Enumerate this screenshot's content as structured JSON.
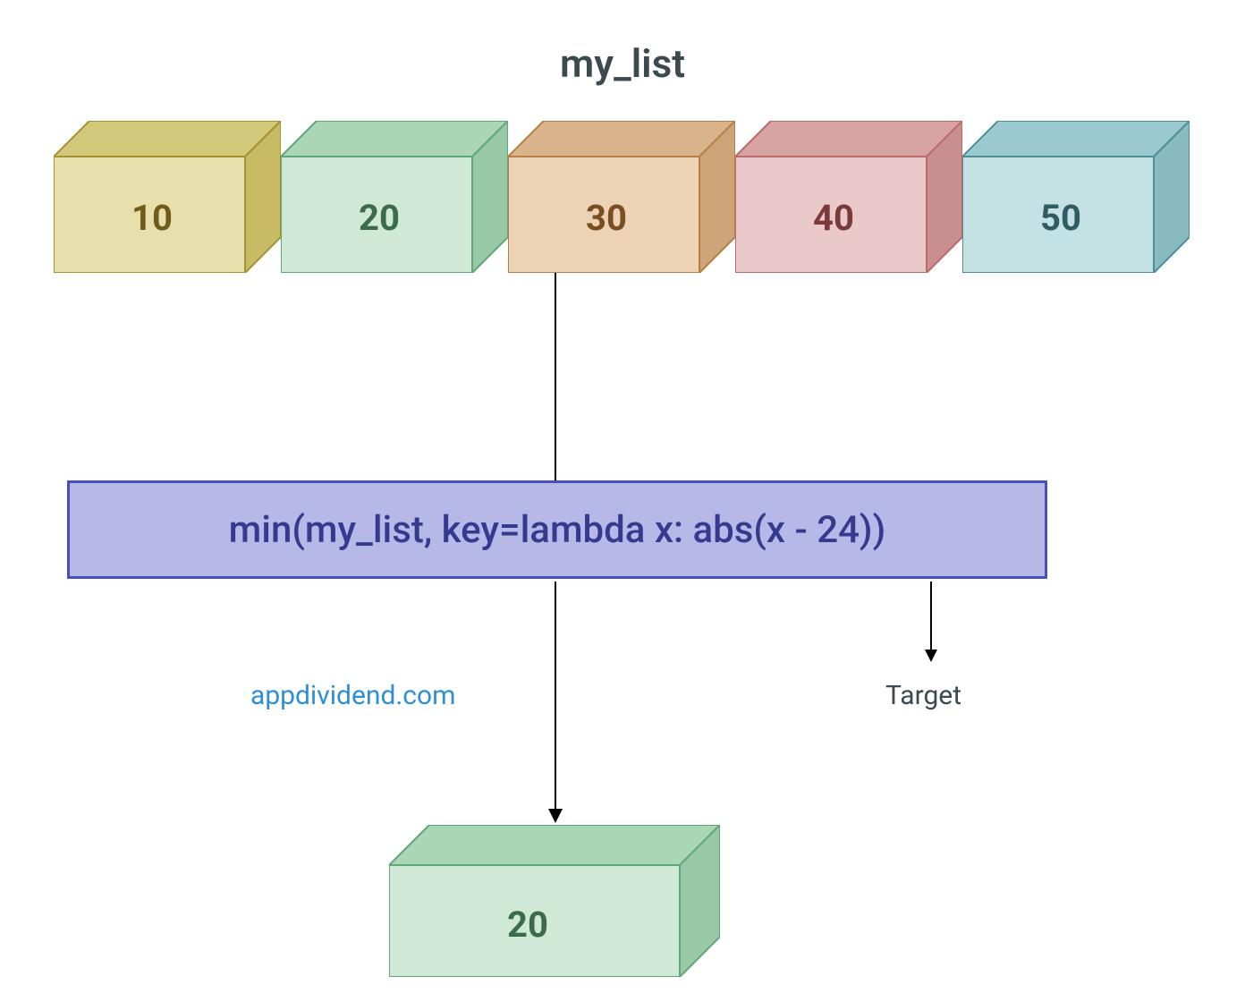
{
  "title": "my_list",
  "blocks": [
    {
      "value": "10",
      "front": "#e7dfac",
      "top": "#d3c87a",
      "side": "#c7bb66",
      "stroke": "#a59233",
      "text": "#6f5c1a"
    },
    {
      "value": "20",
      "front": "#cfe9d6",
      "top": "#aad6b6",
      "side": "#99c8a6",
      "stroke": "#5ea878",
      "text": "#3b6b4a"
    },
    {
      "value": "30",
      "front": "#ecd3b6",
      "top": "#d9b38a",
      "side": "#cca478",
      "stroke": "#b77f46",
      "text": "#7a4e20"
    },
    {
      "value": "40",
      "front": "#e9c9c9",
      "top": "#d7a3a3",
      "side": "#c98f8f",
      "stroke": "#bc6a6a",
      "text": "#7a3a3a"
    },
    {
      "value": "50",
      "front": "#c4e1e4",
      "top": "#9ac9cf",
      "side": "#88bac0",
      "stroke": "#4e8f97",
      "text": "#2e5c62"
    }
  ],
  "code": "min(my_list, key=lambda x: abs(x - 24))",
  "target_label": "Target",
  "watermark": "appdividend.com",
  "result": {
    "value": "20",
    "front": "#cfe9d6",
    "top": "#aad6b6",
    "side": "#99c8a6",
    "stroke": "#5ea878",
    "text": "#3b6b4a"
  },
  "chart_data": {
    "type": "diagram",
    "input_list": [
      10,
      20,
      30,
      40,
      50
    ],
    "operation": "min(my_list, key=lambda x: abs(x - 24))",
    "target": 24,
    "result": 20
  }
}
